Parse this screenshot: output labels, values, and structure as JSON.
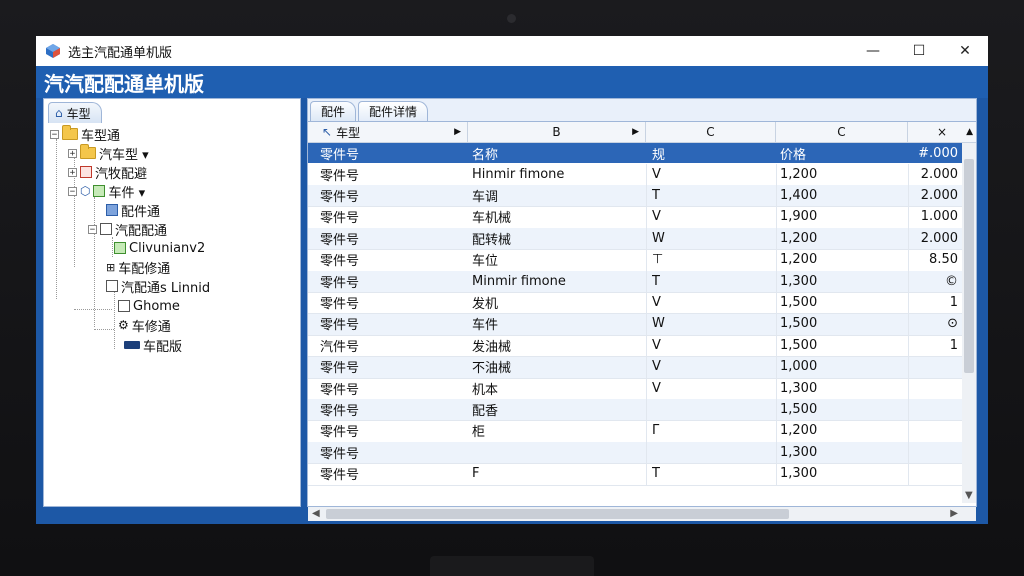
{
  "window": {
    "title": "选主汽配通单机版",
    "minimize": "—",
    "maximize": "☐",
    "close": "✕"
  },
  "header": {
    "title": "汽汽配配通单机版"
  },
  "left_panel": {
    "tab_label": "车型",
    "tab_icon": "home-icon",
    "tree": [
      {
        "label": "车型通",
        "icon": "folder"
      },
      {
        "label": "汽车型 ▾",
        "icon": "folder"
      },
      {
        "label": "汽牧配避",
        "icon": "box-red"
      },
      {
        "label": "车件 ▾",
        "icon": "box-green"
      },
      {
        "label": "配件通",
        "icon": "box-blue"
      },
      {
        "label": "汽配配通",
        "icon": "box"
      },
      {
        "label": "Clivunianv2",
        "icon": "box-green"
      },
      {
        "label": "车配修通",
        "icon": "grid"
      },
      {
        "label": "汽配通s Linnid",
        "icon": "box"
      },
      {
        "label": "Ghome",
        "icon": "box"
      },
      {
        "label": "车修通",
        "icon": "gear"
      },
      {
        "label": "车配版",
        "icon": "folder-blue"
      }
    ]
  },
  "right_panel": {
    "tabs": [
      "配件",
      "配件详情"
    ],
    "column_letters": [
      "车型",
      "B",
      "C",
      "C",
      "×"
    ],
    "header_row": [
      "零件号",
      "名称",
      "规",
      "价格",
      "#.000"
    ],
    "rows": [
      [
        "零件号",
        "Hinmir fimone",
        "V",
        "1,200",
        "2.000"
      ],
      [
        "零件号",
        "车调",
        "T",
        "1,400",
        "2.000"
      ],
      [
        "零件号",
        "车机械",
        "V",
        "1,900",
        "1.000"
      ],
      [
        "零件号",
        "配转械",
        "W",
        "1,200",
        "2.000"
      ],
      [
        "零件号",
        "车位",
        "⊤",
        "1,200",
        "8.50"
      ],
      [
        "零件号",
        "Minmir fimone",
        "T",
        "1,300",
        "©"
      ],
      [
        "零件号",
        "发机",
        "V",
        "1,500",
        "1"
      ],
      [
        "零件号",
        "车件",
        "W",
        "1,500",
        "⊙"
      ],
      [
        "汽件号",
        "发油械",
        "V",
        "1,500",
        "1"
      ],
      [
        "零件号",
        "不油械",
        "V",
        "1,000",
        ""
      ],
      [
        "零件号",
        "机本",
        "V",
        "1,300",
        ""
      ],
      [
        "零件号",
        "配香",
        "",
        "1,500",
        ""
      ],
      [
        "零件号",
        "柜",
        "Γ",
        "1,200",
        ""
      ],
      [
        "零件号",
        "",
        "",
        "1,300",
        ""
      ],
      [
        "零件号",
        "F",
        "T",
        "1,300",
        ""
      ]
    ]
  },
  "colors": {
    "screen_bg": "#1d58a6",
    "header_row_bg": "#2c66b7",
    "alt_row_bg": "#edf3fb"
  }
}
